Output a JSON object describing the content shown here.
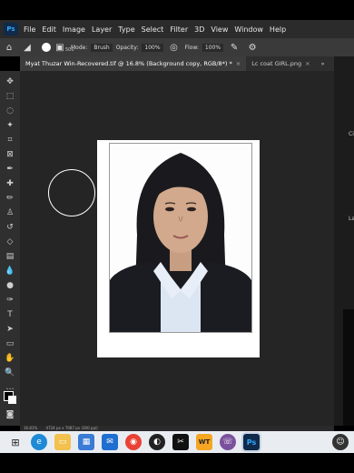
{
  "menubar": {
    "logo": "Ps",
    "items": [
      "File",
      "Edit",
      "Image",
      "Layer",
      "Type",
      "Select",
      "Filter",
      "3D",
      "View",
      "Window",
      "Help"
    ]
  },
  "options": {
    "brush_size": "500",
    "mode_label": "Mode:",
    "mode_value": "Brush",
    "opacity_label": "Opacity:",
    "opacity_value": "100%",
    "flow_label": "Flow:",
    "flow_value": "100%"
  },
  "tabs": [
    {
      "title": "Myat Thuzar Win-Recovered.tif @ 16.8% (Background copy, RGB/8*) *",
      "close": "×"
    },
    {
      "title": "Lc coat GIRL.png",
      "close": "×"
    }
  ],
  "tab_overflow": "»",
  "panel_fragments": {
    "a": "Ci",
    "b": "La"
  },
  "status": {
    "zoom": "16.81%",
    "dims": "4724 px x 7087 px (300 ppi)"
  },
  "taskbar": {
    "icons": [
      "task-view-icon",
      "edge-icon",
      "file-explorer-icon",
      "store-icon",
      "mail-icon",
      "chrome-icon",
      "media-icon",
      "capcut-icon",
      "wt-icon",
      "viber-icon",
      "photoshop-icon"
    ],
    "wt_label": "WT",
    "ps_label": "Ps"
  },
  "colors": {
    "menubar_bg": "#2b2b2b",
    "canvas_bg": "#252525",
    "accent_ps": "#31a8ff"
  }
}
